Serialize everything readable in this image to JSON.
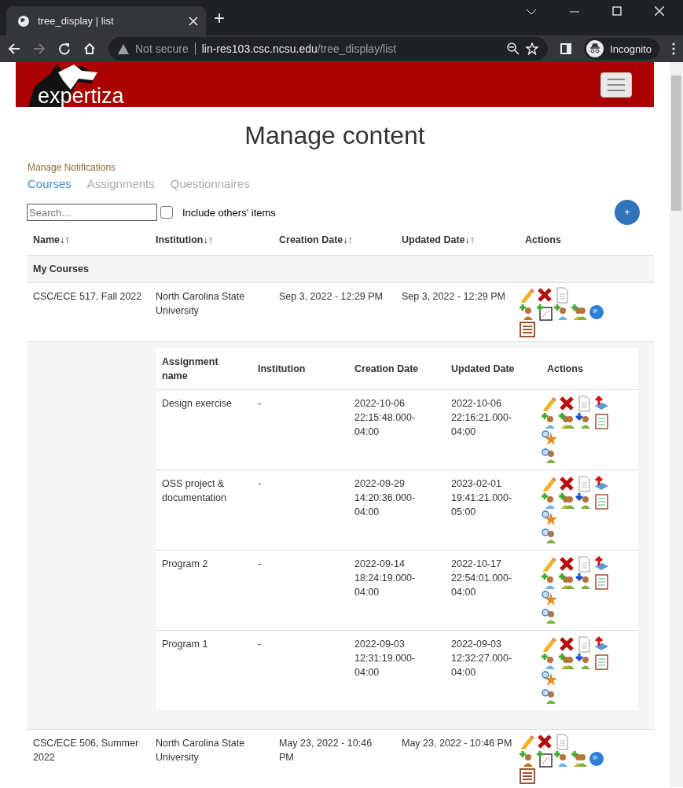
{
  "browser": {
    "tab_title": "tree_display | list",
    "new_tab": "+",
    "security": "Not secure",
    "host": "lin-res103.csc.ncsu.edu",
    "path": "/tree_display/list",
    "profile": "Incognito"
  },
  "header": {
    "logo_text": "expertiza"
  },
  "page": {
    "title": "Manage content",
    "notifications_link": "Manage Notifications",
    "tabs": [
      {
        "label": "Courses",
        "selected": true
      },
      {
        "label": "Assignments",
        "selected": false
      },
      {
        "label": "Questionnaires",
        "selected": false
      }
    ],
    "search": {
      "placeholder": "Search..."
    },
    "include_others": {
      "label": "Include others' items",
      "checked": false
    },
    "add_button": "+"
  },
  "table": {
    "columns": [
      {
        "label": "Name",
        "sort": "↓↑"
      },
      {
        "label": "Institution",
        "sort": "↓↑"
      },
      {
        "label": "Creation Date",
        "sort": "↓↑"
      },
      {
        "label": "Updated Date",
        "sort": "↓↑"
      },
      {
        "label": "Actions"
      }
    ],
    "group": "My Courses",
    "courses": [
      {
        "name": "CSC/ECE 517, Fall 2022",
        "institution": "North Carolina State University",
        "created": "Sep 3, 2022 - 12:29 PM",
        "updated": "Sep 3, 2022 - 12:29 PM",
        "assignments": {
          "columns": [
            "Assignment name",
            "Institution",
            "Creation Date",
            "Updated Date",
            "Actions"
          ],
          "rows": [
            {
              "name": "Design exercise",
              "institution": "-",
              "created": "2022-10-06 22:15:48.000-04:00",
              "updated": "2022-10-06 22:16:21.000-04:00"
            },
            {
              "name": "OSS project & documentation",
              "institution": "-",
              "created": "2022-09-29 14:20:36.000-04:00",
              "updated": "2023-02-01 19:41:21.000-05:00"
            },
            {
              "name": "Program 2",
              "institution": "-",
              "created": "2022-09-14 18:24:19.000-04:00",
              "updated": "2022-10-17 22:54:01.000-04:00"
            },
            {
              "name": "Program 1",
              "institution": "-",
              "created": "2022-09-03 12:31:19.000-04:00",
              "updated": "2022-09-03 12:32:27.000-04:00"
            }
          ]
        }
      },
      {
        "name": "CSC/ECE 506, Summer 2022",
        "institution": "North Carolina State University",
        "created": "May 23, 2022 - 10:46 PM",
        "updated": "May 23, 2022 - 10:46 PM"
      }
    ]
  }
}
